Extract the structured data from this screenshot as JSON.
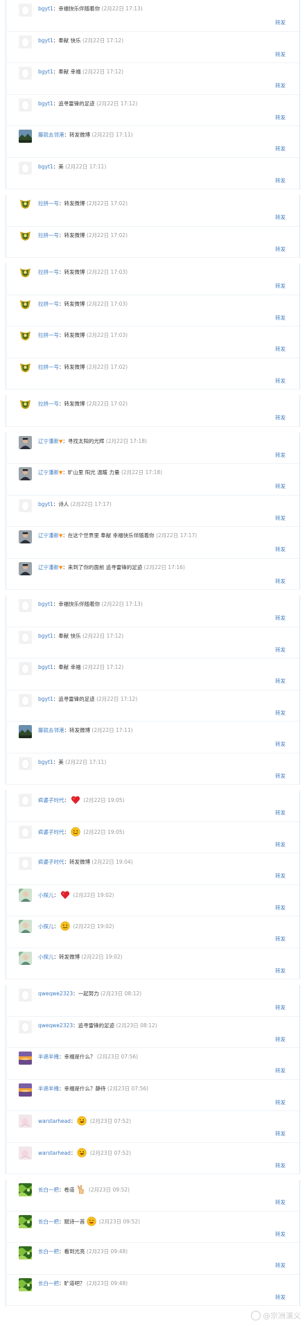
{
  "forward_label": "转发",
  "watermark": "@宗洲演义",
  "groups": [
    {
      "rows": [
        {
          "name": "bgyt1",
          "sep": "：",
          "vip": false,
          "msg": "幸福快乐伴随着你",
          "emo": "",
          "time": "(2月22日 17:13)",
          "avatar": "blank"
        },
        {
          "name": "bgyt1",
          "sep": "：",
          "vip": false,
          "msg": "奉献 快乐",
          "emo": "",
          "time": "(2月22日 17:12)",
          "avatar": "blank"
        },
        {
          "name": "bgyt1",
          "sep": "：",
          "vip": false,
          "msg": "奉献 幸福",
          "emo": "",
          "time": "(2月22日 17:12)",
          "avatar": "blank"
        },
        {
          "name": "bgyt1",
          "sep": "：",
          "vip": false,
          "msg": "追寻雷锋的足迹",
          "emo": "",
          "time": "(2月22日 17:12)",
          "avatar": "blank"
        },
        {
          "name": "藤就去邻港",
          "sep": "：",
          "vip": false,
          "msg": "转发微博",
          "emo": "",
          "time": "(2月22日 17:11)",
          "avatar": "landscape"
        },
        {
          "name": "bgyt1",
          "sep": "：",
          "vip": false,
          "msg": "美",
          "emo": "",
          "time": "(2月22日 17:11)",
          "avatar": "blank"
        }
      ]
    },
    {
      "rows": [
        {
          "name": "拉拼一号",
          "sep": "：",
          "vip": false,
          "msg": "转发微博",
          "emo": "",
          "time": "(2月22日 17:02)",
          "avatar": "crest"
        },
        {
          "name": "拉拼一号",
          "sep": "：",
          "vip": false,
          "msg": "转发微博",
          "emo": "",
          "time": "(2月22日 17:02)",
          "avatar": "crest"
        }
      ]
    },
    {
      "rows": [
        {
          "name": "拉拼一号",
          "sep": "：",
          "vip": false,
          "msg": "转发微博",
          "emo": "",
          "time": "(2月22日 17:03)",
          "avatar": "crest"
        },
        {
          "name": "拉拼一号",
          "sep": "：",
          "vip": false,
          "msg": "转发微博",
          "emo": "",
          "time": "(2月22日 17:03)",
          "avatar": "crest"
        },
        {
          "name": "拉拼一号",
          "sep": "：",
          "vip": false,
          "msg": "转发微博",
          "emo": "",
          "time": "(2月22日 17:03)",
          "avatar": "crest"
        },
        {
          "name": "拉拼一号",
          "sep": "：",
          "vip": false,
          "msg": "转发微博",
          "emo": "",
          "time": "(2月22日 17:02)",
          "avatar": "crest"
        }
      ]
    },
    {
      "rows": [
        {
          "name": "拉拼一号",
          "sep": "：",
          "vip": false,
          "msg": "转发微博",
          "emo": "",
          "time": "(2月22日 17:02)",
          "avatar": "crest"
        }
      ]
    },
    {
      "rows": [
        {
          "name": "辽宁潘新",
          "sep": "：",
          "vip": true,
          "msg": "寻找太阳的光辉",
          "emo": "",
          "time": "(2月22日 17:18)",
          "avatar": "man"
        },
        {
          "name": "辽宁潘新",
          "sep": "：",
          "vip": true,
          "msg": "旷山里 阳光 温暖 力量",
          "emo": "",
          "time": "(2月22日 17:18)",
          "avatar": "man"
        },
        {
          "name": "bgyt1",
          "sep": "：",
          "vip": false,
          "msg": "诗人",
          "emo": "",
          "time": "(2月22日 17:17)",
          "avatar": "blank"
        },
        {
          "name": "辽宁潘新",
          "sep": "：",
          "vip": true,
          "msg": "在这个世界里 奉献 幸福快乐伴随着你",
          "emo": "",
          "time": "(2月22日 17:17)",
          "avatar": "man"
        },
        {
          "name": "辽宁潘新",
          "sep": "：",
          "vip": true,
          "msg": "来到了你的面前 追寻雷锋的足迹",
          "emo": "",
          "time": "(2月22日 17:16)",
          "avatar": "man"
        }
      ]
    },
    {
      "rows": [
        {
          "name": "bgyt1",
          "sep": "：",
          "vip": false,
          "msg": "幸福快乐伴随着你",
          "emo": "",
          "time": "(2月22日 17:13)",
          "avatar": "blank"
        },
        {
          "name": "bgyt1",
          "sep": "：",
          "vip": false,
          "msg": "奉献 快乐",
          "emo": "",
          "time": "(2月22日 17:12)",
          "avatar": "blank"
        },
        {
          "name": "bgyt1",
          "sep": "：",
          "vip": false,
          "msg": "奉献 幸福",
          "emo": "",
          "time": "(2月22日 17:12)",
          "avatar": "blank"
        },
        {
          "name": "bgyt1",
          "sep": "：",
          "vip": false,
          "msg": "追寻雷锋的足迹",
          "emo": "",
          "time": "(2月22日 17:12)",
          "avatar": "blank"
        },
        {
          "name": "藤就去邻港",
          "sep": "：",
          "vip": false,
          "msg": "转发微博",
          "emo": "",
          "time": "(2月22日 17:11)",
          "avatar": "landscape"
        },
        {
          "name": "bgyt1",
          "sep": "：",
          "vip": false,
          "msg": "美",
          "emo": "",
          "time": "(2月22日 17:11)",
          "avatar": "blank"
        }
      ]
    },
    {
      "rows": [
        {
          "name": "疯婆子时代",
          "sep": "：",
          "vip": false,
          "msg": "",
          "emo": "heart",
          "time": "(2月22日 19:05)",
          "avatar": "blank"
        },
        {
          "name": "疯婆子时代",
          "sep": "：",
          "vip": false,
          "msg": "",
          "emo": "smile",
          "time": "(2月22日 19:05)",
          "avatar": "blank"
        },
        {
          "name": "疯婆子时代",
          "sep": "：",
          "vip": false,
          "msg": "转发微博",
          "emo": "",
          "time": "(2月22日 19:04)",
          "avatar": "blank"
        },
        {
          "name": "小探儿",
          "sep": "：",
          "vip": false,
          "msg": "",
          "emo": "heart",
          "time": "(2月22日 19:02)",
          "avatar": "photo"
        },
        {
          "name": "小探儿",
          "sep": "：",
          "vip": false,
          "msg": "",
          "emo": "smile",
          "time": "(2月22日 19:02)",
          "avatar": "photo"
        },
        {
          "name": "小探儿",
          "sep": "：",
          "vip": false,
          "msg": "转发微博",
          "emo": "",
          "time": "(2月22日 19:02)",
          "avatar": "photo"
        }
      ]
    },
    {
      "rows": [
        {
          "name": "qweqwe2323",
          "sep": "：",
          "vip": false,
          "msg": "一起努力",
          "emo": "",
          "time": "(2月23日 08:12)",
          "avatar": "blank"
        },
        {
          "name": "qweqwe2323",
          "sep": "：",
          "vip": false,
          "msg": "追寻雷锋的足迹",
          "emo": "",
          "time": "(2月23日 08:12)",
          "avatar": "blank"
        },
        {
          "name": "半遮半掩",
          "sep": "：",
          "vip": false,
          "msg": "幸福是什么？",
          "emo": "",
          "time": "(2月23日 07:56)",
          "avatar": "sunset"
        },
        {
          "name": "半遮半掩",
          "sep": "：",
          "vip": false,
          "msg": "幸福是什么？静待",
          "emo": "",
          "time": "(2月23日 07:56)",
          "avatar": "sunset"
        },
        {
          "name": "warstarhead",
          "sep": "：",
          "vip": false,
          "msg": "",
          "emo": "grin",
          "time": "(2月23日 07:52)",
          "avatar": "pink"
        },
        {
          "name": "warstarhead",
          "sep": "：",
          "vip": false,
          "msg": "",
          "emo": "grin",
          "time": "(2月23日 07:52)",
          "avatar": "pink"
        }
      ]
    },
    {
      "rows": [
        {
          "name": "长白一把",
          "sep": "：",
          "vip": false,
          "msg": "卷道",
          "emo": "yeah",
          "time": "(2月23日 09:52)",
          "avatar": "green"
        },
        {
          "name": "长白一把",
          "sep": "：",
          "vip": false,
          "msg": "赋诗一首",
          "emo": "laugh",
          "time": "(2月23日 09:52)",
          "avatar": "green"
        },
        {
          "name": "长白一把",
          "sep": "：",
          "vip": false,
          "msg": "看到光亮",
          "emo": "",
          "time": "(2月23日 09:48)",
          "avatar": "green"
        },
        {
          "name": "长白一把",
          "sep": "：",
          "vip": false,
          "msg": "旷道吧？",
          "emo": "",
          "time": "(2月23日 09:48)",
          "avatar": "green"
        }
      ]
    }
  ]
}
